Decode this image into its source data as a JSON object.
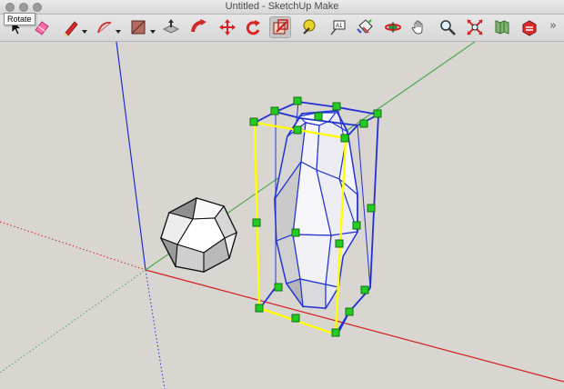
{
  "window": {
    "title": "Untitled - SketchUp Make"
  },
  "tooltip": {
    "text": "Rotate"
  },
  "toolbar": {
    "tools": [
      {
        "name": "select"
      },
      {
        "name": "eraser"
      },
      {
        "name": "line"
      },
      {
        "name": "arc"
      },
      {
        "name": "rectangle"
      },
      {
        "name": "push-pull"
      },
      {
        "name": "follow-me"
      },
      {
        "name": "move"
      },
      {
        "name": "rotate"
      },
      {
        "name": "scale"
      },
      {
        "name": "tape-measure"
      },
      {
        "name": "text"
      },
      {
        "name": "paint-bucket"
      },
      {
        "name": "orbit"
      },
      {
        "name": "pan"
      },
      {
        "name": "zoom"
      },
      {
        "name": "zoom-extents"
      },
      {
        "name": "model-info"
      },
      {
        "name": "extension-warehouse"
      }
    ],
    "text_tool_label": "A1",
    "overflow_symbol": "»"
  },
  "colors": {
    "toolbar_bg": "#dddddd",
    "viewport_bg": "#d9d6d2",
    "blue_axis": "#1f2fd1",
    "red_axis": "#d21f1f",
    "green_axis": "#4ea94e",
    "selection_yellow": "#ffff00",
    "grip_green": "#22cc22",
    "active_tool_bg": "#c5c5c5"
  }
}
